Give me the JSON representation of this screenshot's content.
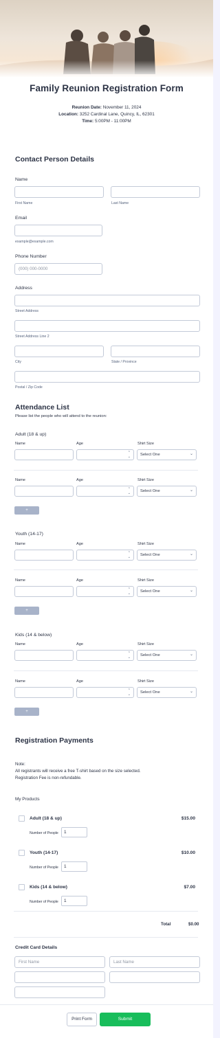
{
  "form": {
    "title": "Family Reunion Registration Form",
    "event": {
      "date_label": "Reunion Date:",
      "date_value": "November 11, 2024",
      "location_label": "Location:",
      "location_value": "3252 Cardinal Lane, Quincy, IL, 62301",
      "time_label": "Time:",
      "time_value": "5:00PM - 11:00PM"
    }
  },
  "contact": {
    "section_title": "Contact Person Details",
    "name_label": "Name",
    "first_name_sublabel": "First Name",
    "last_name_sublabel": "Last Name",
    "email_label": "Email",
    "email_sublabel": "example@example.com",
    "phone_label": "Phone Number",
    "phone_placeholder": "(000) 000-0000",
    "address_label": "Address",
    "street_sublabel": "Street Address",
    "street2_sublabel": "Street Address Line 2",
    "city_sublabel": "City",
    "state_sublabel": "State / Province",
    "zip_sublabel": "Postal / Zip Code"
  },
  "attendance": {
    "section_title": "Attendance List",
    "description": "Please list the people who will attend to the reunion:",
    "col_name": "Name",
    "col_age": "Age",
    "col_shirt": "Shirt Size",
    "select_placeholder": "Select One",
    "add_label": "+",
    "groups": [
      {
        "title": "Adult (18 & up)"
      },
      {
        "title": "Youth (14-17)"
      },
      {
        "title": "Kids (14 & below)"
      }
    ]
  },
  "payments": {
    "section_title": "Registration Payments",
    "note_line1": "Note:",
    "note_line2": "All registrants will receive a free T-shirt based on the size selected.",
    "note_line3": "Registration Fee is non-refundable.",
    "products_label": "My Products",
    "quantity_label": "Number of People",
    "products": [
      {
        "name": "Adult (18 & up)",
        "price": "$15.00",
        "quantity": "1"
      },
      {
        "name": "Youth (14-17)",
        "price": "$10.00",
        "quantity": "1"
      },
      {
        "name": "Kids (14 & below)",
        "price": "$7.00",
        "quantity": "1"
      }
    ],
    "total_label": "Total",
    "total_value": "$0.00",
    "credit_card_title": "Credit Card Details",
    "cc_first_placeholder": "First Name",
    "cc_last_placeholder": "Last Name"
  },
  "actions": {
    "print_label": "Print Form",
    "submit_label": "Submit",
    "submit_color": "#18bd5b"
  }
}
